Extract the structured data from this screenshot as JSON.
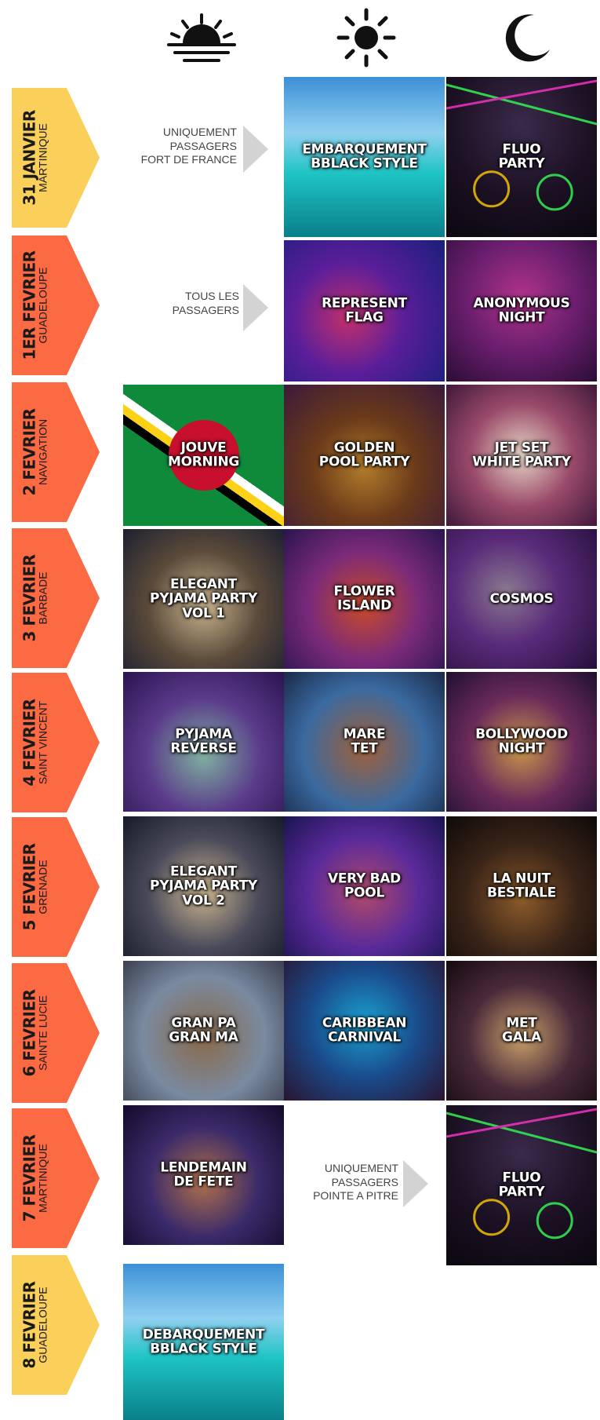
{
  "header_icons": [
    "sunrise-icon",
    "sun-icon",
    "moon-icon"
  ],
  "days": [
    {
      "date": "31 JANVIER",
      "place": "MARTINIQUE",
      "color": "#fbd05a"
    },
    {
      "date": "1ER FEVRIER",
      "place": "GUADELOUPE",
      "color": "#fb6a43"
    },
    {
      "date": "2 FEVRIER",
      "place": "NAVIGATION",
      "color": "#fb6a43"
    },
    {
      "date": "3 FEVRIER",
      "place": "BARBADE",
      "color": "#fb6a43"
    },
    {
      "date": "4 FEVRIER",
      "place": "SAINT VINCENT",
      "color": "#fb6a43"
    },
    {
      "date": "5 FEVRIER",
      "place": "GRENADE",
      "color": "#fb6a43"
    },
    {
      "date": "6 FEVRIER",
      "place": "SAINTE LUCIE",
      "color": "#fb6a43"
    },
    {
      "date": "7 FEVRIER",
      "place": "MARTINIQUE",
      "color": "#fb6a43"
    },
    {
      "date": "8 FEVRIER",
      "place": "GUADELOUPE",
      "color": "#fbd05a"
    }
  ],
  "notes": [
    {
      "lines": [
        "UNIQUEMENT",
        "PASSAGERS",
        "FORT DE FRANCE"
      ]
    },
    {
      "lines": [
        "TOUS LES",
        "PASSAGERS"
      ]
    },
    {
      "lines": [
        "UNIQUEMENT",
        "PASSAGERS",
        "POINTE A PITRE"
      ]
    }
  ],
  "events": [
    {
      "label": "EMBARQUEMENT\nBBLACK STYLE"
    },
    {
      "label": "FLUO\nPARTY"
    },
    {
      "label": "REPRESENT\nFLAG"
    },
    {
      "label": "ANONYMOUS\nNIGHT"
    },
    {
      "label": "JOUVE\nMORNING"
    },
    {
      "label": "GOLDEN\nPOOL PARTY"
    },
    {
      "label": "JET SET\nWHITE PARTY"
    },
    {
      "label": "ELEGANT\nPYJAMA PARTY\nVOL 1"
    },
    {
      "label": "FLOWER\nISLAND"
    },
    {
      "label": "COSMOS"
    },
    {
      "label": "PYJAMA\nREVERSE"
    },
    {
      "label": "MARE\nTET"
    },
    {
      "label": "BOLLYWOOD\nNIGHT"
    },
    {
      "label": "ELEGANT\nPYJAMA PARTY\nVOL 2"
    },
    {
      "label": "VERY BAD\nPOOL"
    },
    {
      "label": "LA NUIT\nBESTIALE"
    },
    {
      "label": "GRAN PA\nGRAN MA"
    },
    {
      "label": "CARIBBEAN\nCARNIVAL"
    },
    {
      "label": "MET\nGALA"
    },
    {
      "label": "LENDEMAIN\nDE FETE"
    },
    {
      "label": "FLUO\nPARTY"
    },
    {
      "label": "DEBARQUEMENT\nBBLACK STYLE"
    }
  ]
}
